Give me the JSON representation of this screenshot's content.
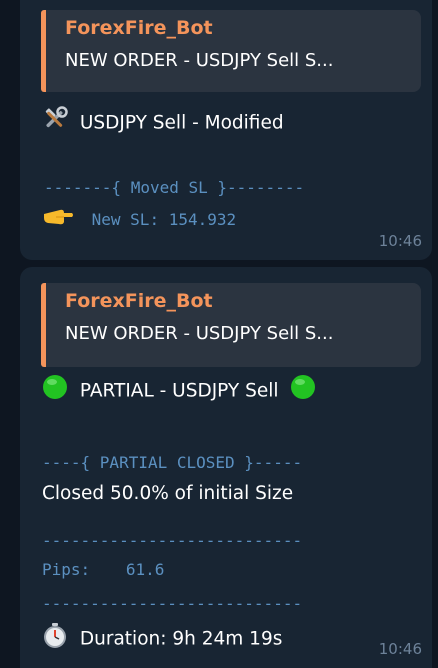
{
  "messages": [
    {
      "reply": {
        "sender": "ForexFire_Bot",
        "text": "NEW ORDER - USDJPY Sell S..."
      },
      "title_icon": "hammer-wrench-icon",
      "title": "USDJPY Sell - Modified",
      "section_header": "-------{ Moved SL }--------",
      "detail_icon": "pointing-hand-icon",
      "detail": "New SL: 154.932",
      "time": "10:46"
    },
    {
      "reply": {
        "sender": "ForexFire_Bot",
        "text": "NEW ORDER - USDJPY Sell S..."
      },
      "title_icon": "green-circle-icon",
      "title": "PARTIAL - USDJPY Sell",
      "section_header": "----{ PARTIAL CLOSED }-----",
      "closed_text": "Closed 50.0% of initial Size",
      "divider": "---------------------------",
      "pips_label": "Pips:",
      "pips_value": "61.6",
      "duration_icon": "stopwatch-icon",
      "duration": "Duration: 9h 24m 19s",
      "time": "10:46"
    }
  ],
  "colors": {
    "background": "#0e1621",
    "bubble": "#182533",
    "reply_bg": "#2b3440",
    "accent_orange": "#f4945b",
    "mono_blue": "#5b90c0",
    "time_gray": "#6d8299",
    "green": "#22c322"
  }
}
